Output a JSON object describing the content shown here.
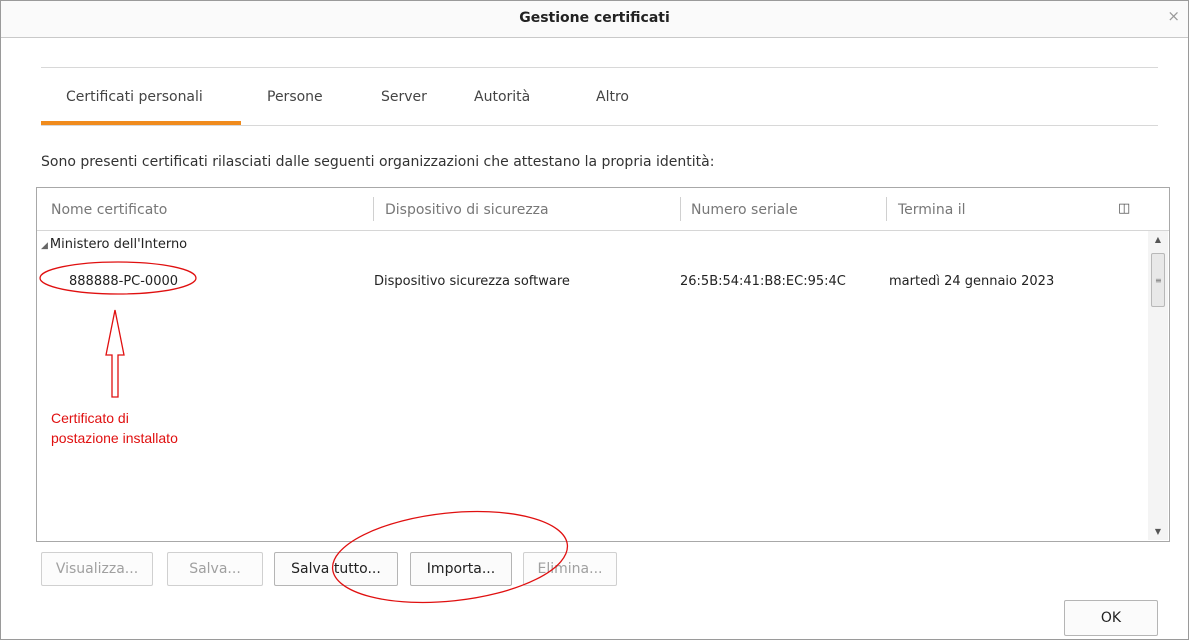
{
  "window": {
    "title": "Gestione certificati",
    "close_symbol": "×"
  },
  "tabs": [
    {
      "label": "Certificati personali",
      "active": true
    },
    {
      "label": "Persone",
      "active": false
    },
    {
      "label": "Server",
      "active": false
    },
    {
      "label": "Autorità",
      "active": false
    },
    {
      "label": "Altro",
      "active": false
    }
  ],
  "description": "Sono presenti certificati rilasciati dalle seguenti organizzazioni che attestano la propria identità:",
  "table": {
    "columns": [
      "Nome certificato",
      "Dispositivo di sicurezza",
      "Numero seriale",
      "Termina il"
    ],
    "groups": [
      {
        "name": "Ministero dell'Interno",
        "rows": [
          {
            "name": "888888-PC-0000",
            "device": "Dispositivo sicurezza software",
            "serial": "26:5B:54:41:B8:EC:95:4C",
            "expires": "martedì 24 gennaio 2023"
          }
        ]
      }
    ]
  },
  "annotation": {
    "line1": "Certificato di",
    "line2": "postazione installato",
    "color": "#e01010"
  },
  "buttons": {
    "view": "Visualizza...",
    "save": "Salva...",
    "save_all": "Salva tutto...",
    "import": "Importa...",
    "delete": "Elimina...",
    "ok": "OK"
  },
  "colors": {
    "accent": "#f08b1d",
    "annotation": "#e01010"
  }
}
